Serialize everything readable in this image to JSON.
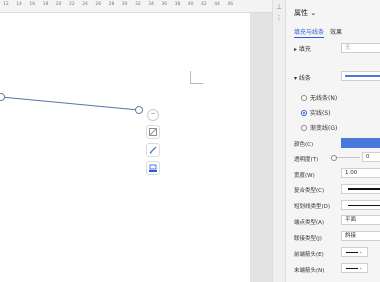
{
  "ruler": {
    "numbers": [
      "12",
      "14",
      "16",
      "18",
      "20",
      "22",
      "24",
      "26",
      "28",
      "30",
      "32",
      "34",
      "36",
      "38",
      "40",
      "42",
      "44",
      "46"
    ]
  },
  "float_toolbar": {
    "top_label": "−"
  },
  "panel": {
    "title": "属性 ⌄",
    "tabs": [
      "填充与线条",
      "效果"
    ],
    "fill_section": "▸ 填充",
    "fill_value": "无",
    "line_section": "▾ 线条",
    "radios": [
      "无线条(N)",
      "实线(S)",
      "渐变线(G)"
    ],
    "selected_radio": 1,
    "labels": {
      "color": "颜色(C)",
      "transparency": "透明度(T)",
      "width": "宽度(W)",
      "compound": "复合类型(C)",
      "dash": "短划线类型(D)",
      "cap": "端点类型(A)",
      "join": "联接类型(J)",
      "begin_arrow": "前端箭头(E)",
      "end_arrow": "末端箭头(N)"
    },
    "values": {
      "transparency": "0",
      "width": "1.00",
      "cap": "平面",
      "join": "斜接"
    },
    "accent_color": "#2a5bd7",
    "line_color": "#4a78d8"
  },
  "shape_line": {
    "stroke": "#5b73a8"
  }
}
